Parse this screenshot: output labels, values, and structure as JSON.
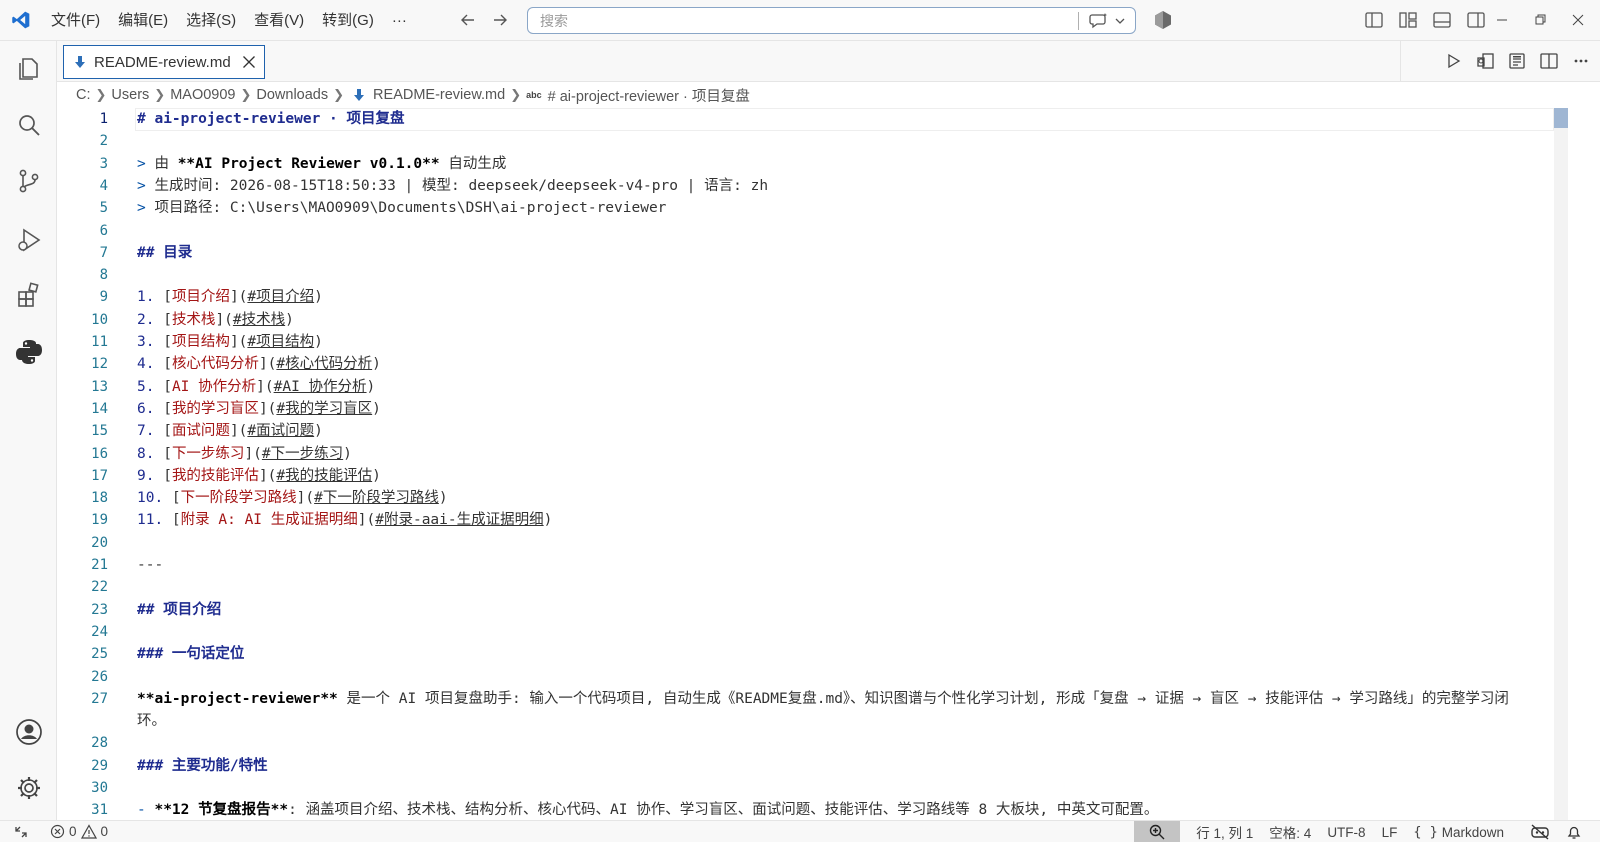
{
  "menu": [
    "文件(F)",
    "编辑(E)",
    "选择(S)",
    "查看(V)",
    "转到(G)",
    "···"
  ],
  "search": {
    "placeholder": "搜索"
  },
  "tab": {
    "label": "README-review.md"
  },
  "breadcrumb": [
    "C:",
    "Users",
    "MAO0909",
    "Downloads",
    "README-review.md",
    "# ai-project-reviewer · 项目复盘"
  ],
  "breadcrumb_symbol_badge": "abc",
  "lines": [
    {
      "n": "1",
      "parts": [
        {
          "c": "h",
          "t": "# ai-project-reviewer · 项目复盘"
        }
      ]
    },
    {
      "n": "2",
      "parts": []
    },
    {
      "n": "3",
      "parts": [
        {
          "c": "q",
          "t": "> "
        },
        {
          "c": "",
          "t": "由 "
        },
        {
          "c": "bold",
          "t": "**AI Project Reviewer v0.1.0**"
        },
        {
          "c": "",
          "t": " 自动生成"
        }
      ]
    },
    {
      "n": "4",
      "parts": [
        {
          "c": "q",
          "t": "> "
        },
        {
          "c": "",
          "t": "生成时间: 2026-08-15T18:50:33 | 模型: deepseek/deepseek-v4-pro | 语言: zh"
        }
      ]
    },
    {
      "n": "5",
      "parts": [
        {
          "c": "q",
          "t": "> "
        },
        {
          "c": "",
          "t": "项目路径: C:\\Users\\MAO0909\\Documents\\DSH\\ai-project-reviewer"
        }
      ]
    },
    {
      "n": "6",
      "parts": []
    },
    {
      "n": "7",
      "parts": [
        {
          "c": "h",
          "t": "## 目录"
        }
      ]
    },
    {
      "n": "8",
      "parts": []
    },
    {
      "n": "9",
      "parts": [
        {
          "c": "num",
          "t": "1. "
        },
        {
          "c": "",
          "t": "["
        },
        {
          "c": "link",
          "t": "项目介绍"
        },
        {
          "c": "",
          "t": "]("
        },
        {
          "c": "lt",
          "t": "#项目介绍"
        },
        {
          "c": "",
          "t": ")"
        }
      ]
    },
    {
      "n": "10",
      "parts": [
        {
          "c": "num",
          "t": "2. "
        },
        {
          "c": "",
          "t": "["
        },
        {
          "c": "link",
          "t": "技术栈"
        },
        {
          "c": "",
          "t": "]("
        },
        {
          "c": "lt",
          "t": "#技术栈"
        },
        {
          "c": "",
          "t": ")"
        }
      ]
    },
    {
      "n": "11",
      "parts": [
        {
          "c": "num",
          "t": "3. "
        },
        {
          "c": "",
          "t": "["
        },
        {
          "c": "link",
          "t": "项目结构"
        },
        {
          "c": "",
          "t": "]("
        },
        {
          "c": "lt",
          "t": "#项目结构"
        },
        {
          "c": "",
          "t": ")"
        }
      ]
    },
    {
      "n": "12",
      "parts": [
        {
          "c": "num",
          "t": "4. "
        },
        {
          "c": "",
          "t": "["
        },
        {
          "c": "link",
          "t": "核心代码分析"
        },
        {
          "c": "",
          "t": "]("
        },
        {
          "c": "lt",
          "t": "#核心代码分析"
        },
        {
          "c": "",
          "t": ")"
        }
      ]
    },
    {
      "n": "13",
      "parts": [
        {
          "c": "num",
          "t": "5. "
        },
        {
          "c": "",
          "t": "["
        },
        {
          "c": "link",
          "t": "AI 协作分析"
        },
        {
          "c": "",
          "t": "]("
        },
        {
          "c": "lt",
          "t": "#AI 协作分析"
        },
        {
          "c": "",
          "t": ")"
        }
      ]
    },
    {
      "n": "14",
      "parts": [
        {
          "c": "num",
          "t": "6. "
        },
        {
          "c": "",
          "t": "["
        },
        {
          "c": "link",
          "t": "我的学习盲区"
        },
        {
          "c": "",
          "t": "]("
        },
        {
          "c": "lt",
          "t": "#我的学习盲区"
        },
        {
          "c": "",
          "t": ")"
        }
      ]
    },
    {
      "n": "15",
      "parts": [
        {
          "c": "num",
          "t": "7. "
        },
        {
          "c": "",
          "t": "["
        },
        {
          "c": "link",
          "t": "面试问题"
        },
        {
          "c": "",
          "t": "]("
        },
        {
          "c": "lt",
          "t": "#面试问题"
        },
        {
          "c": "",
          "t": ")"
        }
      ]
    },
    {
      "n": "16",
      "parts": [
        {
          "c": "num",
          "t": "8. "
        },
        {
          "c": "",
          "t": "["
        },
        {
          "c": "link",
          "t": "下一步练习"
        },
        {
          "c": "",
          "t": "]("
        },
        {
          "c": "lt",
          "t": "#下一步练习"
        },
        {
          "c": "",
          "t": ")"
        }
      ]
    },
    {
      "n": "17",
      "parts": [
        {
          "c": "num",
          "t": "9. "
        },
        {
          "c": "",
          "t": "["
        },
        {
          "c": "link",
          "t": "我的技能评估"
        },
        {
          "c": "",
          "t": "]("
        },
        {
          "c": "lt",
          "t": "#我的技能评估"
        },
        {
          "c": "",
          "t": ")"
        }
      ]
    },
    {
      "n": "18",
      "parts": [
        {
          "c": "num",
          "t": "10. "
        },
        {
          "c": "",
          "t": "["
        },
        {
          "c": "link",
          "t": "下一阶段学习路线"
        },
        {
          "c": "",
          "t": "]("
        },
        {
          "c": "lt",
          "t": "#下一阶段学习路线"
        },
        {
          "c": "",
          "t": ")"
        }
      ]
    },
    {
      "n": "19",
      "parts": [
        {
          "c": "num",
          "t": "11. "
        },
        {
          "c": "",
          "t": "["
        },
        {
          "c": "link",
          "t": "附录 A: AI 生成证据明细"
        },
        {
          "c": "",
          "t": "]("
        },
        {
          "c": "lt",
          "t": "#附录-aai-生成证据明细"
        },
        {
          "c": "",
          "t": ")"
        }
      ]
    },
    {
      "n": "20",
      "parts": []
    },
    {
      "n": "21",
      "parts": [
        {
          "c": "",
          "t": "---"
        }
      ]
    },
    {
      "n": "22",
      "parts": []
    },
    {
      "n": "23",
      "parts": [
        {
          "c": "h",
          "t": "## 项目介绍"
        }
      ]
    },
    {
      "n": "24",
      "parts": []
    },
    {
      "n": "25",
      "parts": [
        {
          "c": "h",
          "t": "### 一句话定位"
        }
      ]
    },
    {
      "n": "26",
      "parts": []
    },
    {
      "n": "27",
      "wrap": true,
      "parts": [
        {
          "c": "bold",
          "t": "**ai-project-reviewer**"
        },
        {
          "c": "",
          "t": " 是一个 AI 项目复盘助手: 输入一个代码项目, 自动生成《README复盘.md》、知识图谱与个性化学习计划, 形成「复盘 → 证据 → 盲区 → 技能评估 → 学习路线」的完整学习闭环。"
        }
      ]
    },
    {
      "n": "28",
      "parts": []
    },
    {
      "n": "29",
      "parts": [
        {
          "c": "h",
          "t": "### 主要功能/特性"
        }
      ]
    },
    {
      "n": "30",
      "parts": []
    },
    {
      "n": "31",
      "parts": [
        {
          "c": "q",
          "t": "- "
        },
        {
          "c": "bold",
          "t": "**12 节复盘报告**"
        },
        {
          "c": "",
          "t": ": 涵盖项目介绍、技术栈、结构分析、核心代码、AI 协作、学习盲区、面试问题、技能评估、学习路线等 8 大板块, 中英文可配置。"
        }
      ]
    }
  ],
  "status": {
    "errors": "0",
    "warnings": "0",
    "position": "行 1, 列 1",
    "spaces": "空格: 4",
    "encoding": "UTF-8",
    "eol": "LF",
    "language": "Markdown"
  },
  "colors": {
    "accent": "#1f62ad",
    "heading": "#1f2c8f",
    "link_text": "#a31515",
    "line_number": "#237893"
  }
}
